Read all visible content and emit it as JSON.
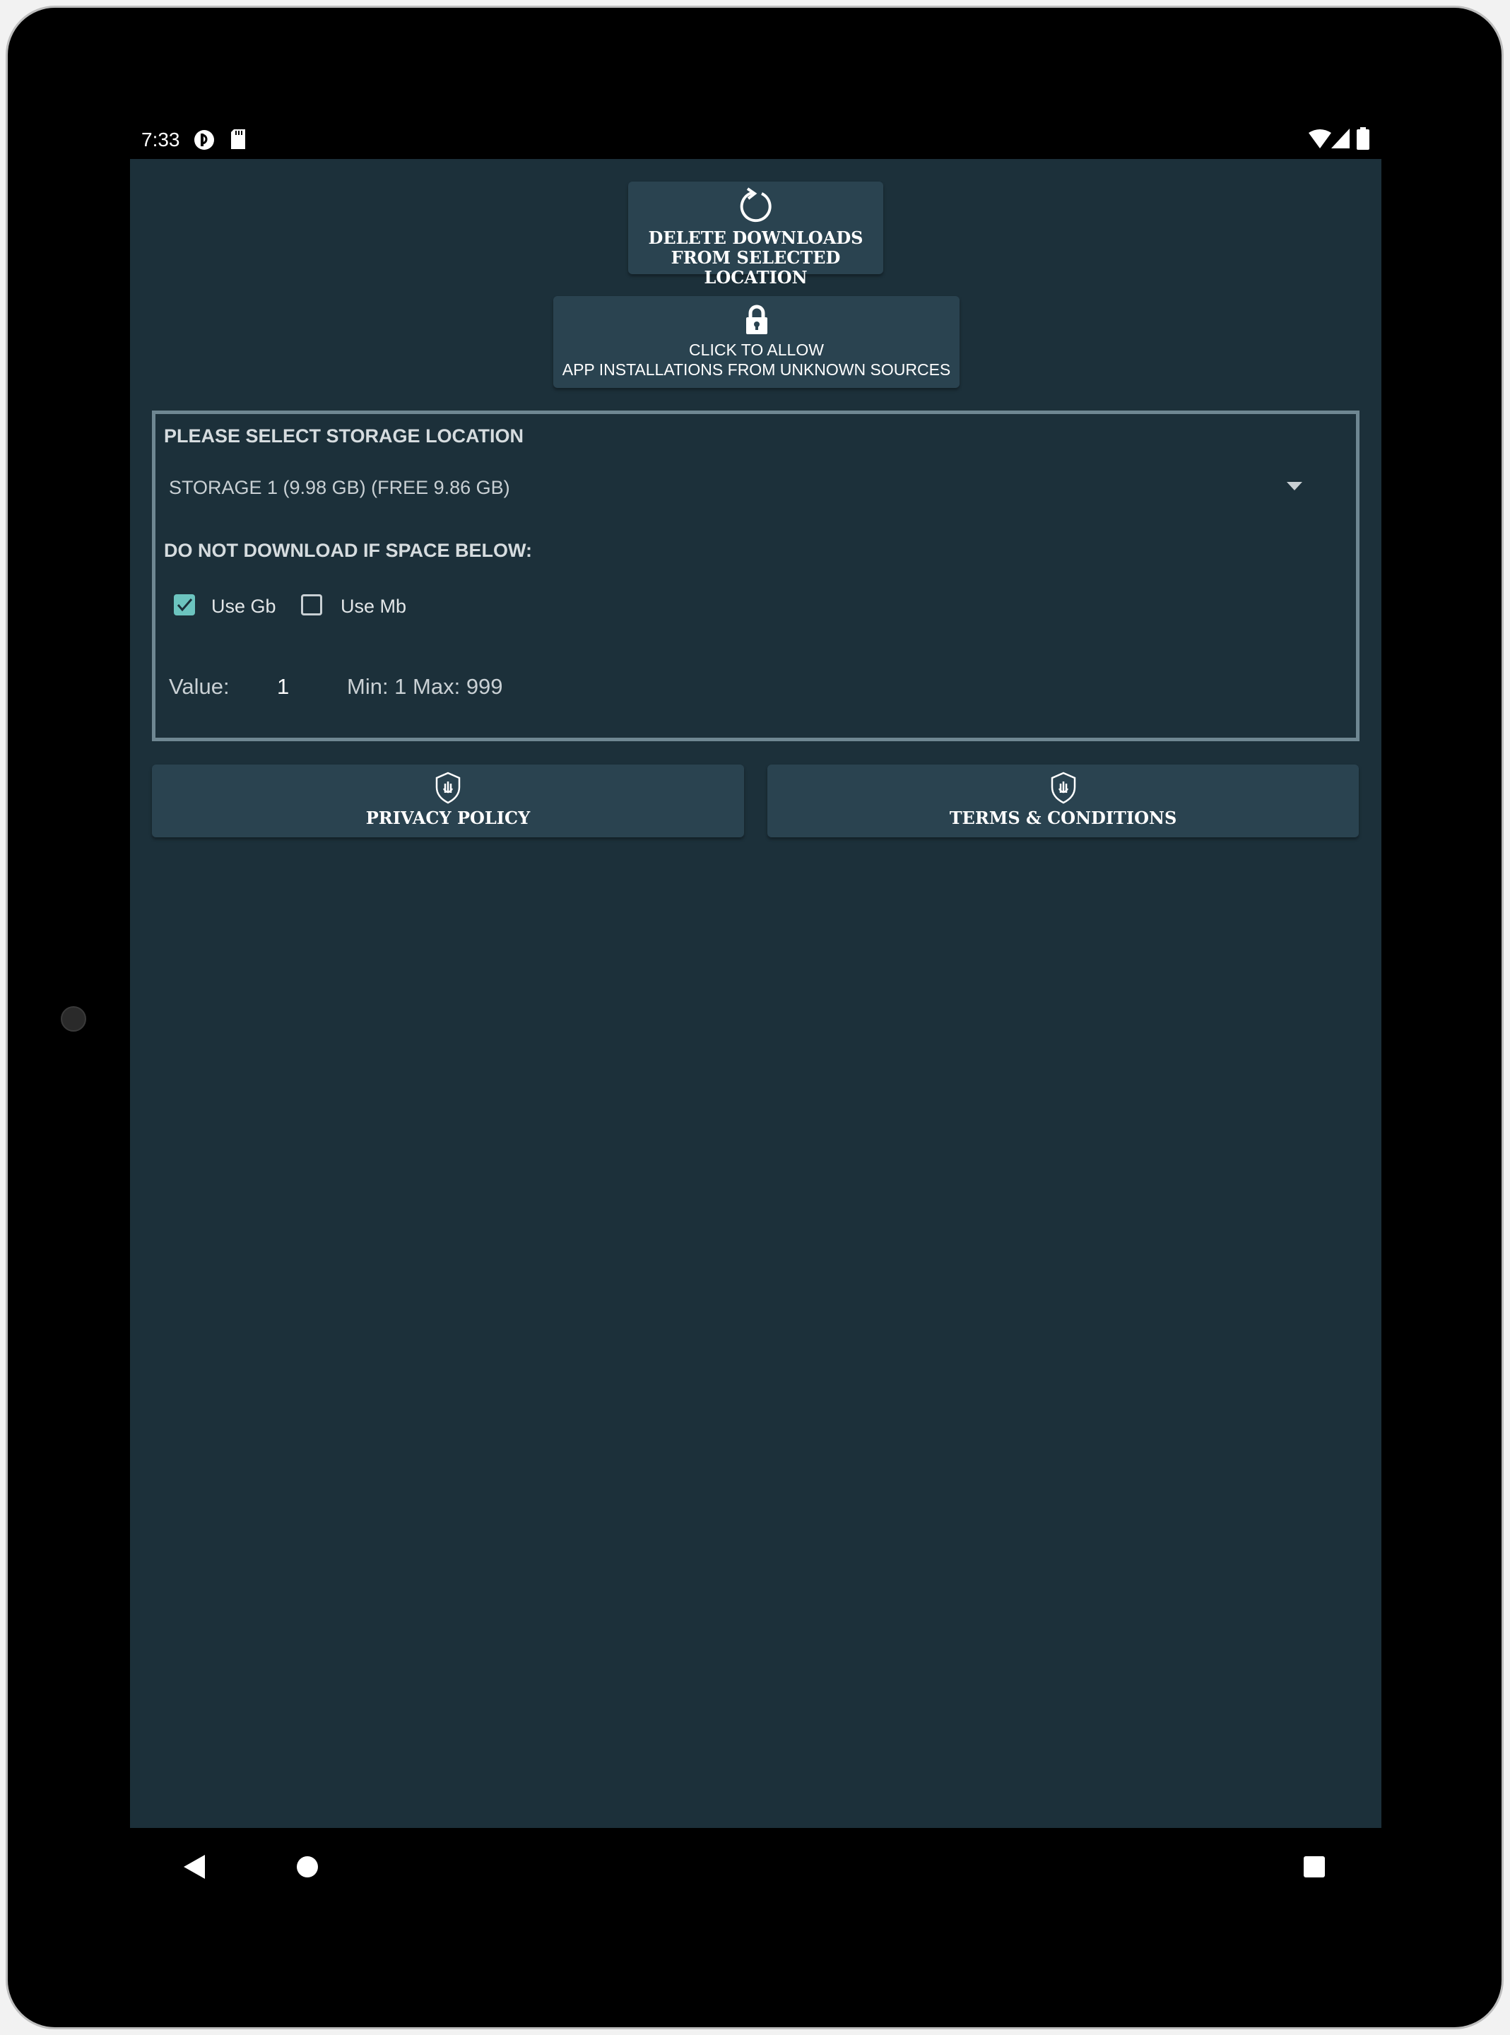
{
  "status_bar": {
    "time": "7:33",
    "left_icons": [
      "data-saver-icon",
      "sd-card-icon"
    ],
    "right_icons": [
      "wifi-icon",
      "signal-icon",
      "battery-icon"
    ]
  },
  "actions": {
    "delete_downloads": {
      "line1": "DELETE DOWNLOADS",
      "line2": "FROM SELECTED LOCATION",
      "icon": "refresh-icon"
    },
    "unknown_sources": {
      "line1": "CLICK TO ALLOW",
      "line2": "APP INSTALLATIONS FROM UNKNOWN SOURCES",
      "icon": "lock-icon"
    }
  },
  "storage": {
    "title": "PLEASE SELECT STORAGE LOCATION",
    "selected": "STORAGE 1 (9.98 GB) (FREE 9.86 GB)",
    "threshold_title": "DO NOT DOWNLOAD IF SPACE BELOW:",
    "use_gb": {
      "label": "Use Gb",
      "checked": true
    },
    "use_mb": {
      "label": "Use Mb",
      "checked": false
    },
    "value_label": "Value:",
    "value": "1",
    "range": "Min: 1 Max: 999"
  },
  "footer_buttons": {
    "privacy": "PRIVACY POLICY",
    "terms": "TERMS & CONDITIONS",
    "icon": "shield-hand-icon"
  },
  "colors": {
    "background": "#1c303a",
    "button": "#2a4350",
    "accent": "#6cc4bf",
    "border": "#6f8792"
  }
}
